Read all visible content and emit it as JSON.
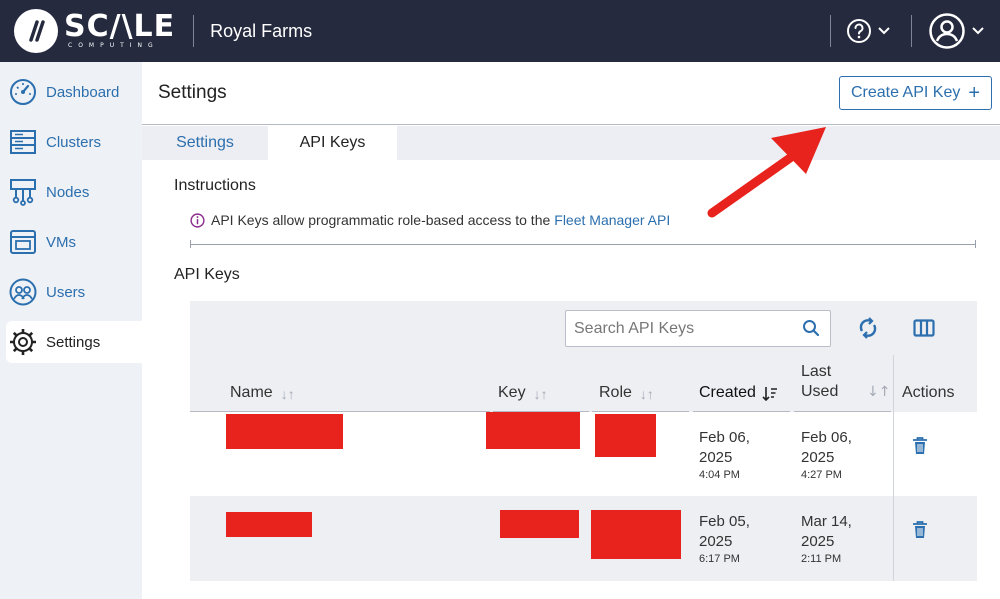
{
  "header": {
    "logo_word": "SC/\\LE",
    "logo_sub": "COMPUTING",
    "org_name": "Royal Farms"
  },
  "sidebar": {
    "items": [
      {
        "label": "Dashboard",
        "icon": "dashboard-gauge-icon"
      },
      {
        "label": "Clusters",
        "icon": "clusters-icon"
      },
      {
        "label": "Nodes",
        "icon": "nodes-icon"
      },
      {
        "label": "VMs",
        "icon": "vms-icon"
      },
      {
        "label": "Users",
        "icon": "users-icon"
      },
      {
        "label": "Settings",
        "icon": "gear-icon",
        "active": true
      }
    ]
  },
  "page": {
    "title": "Settings",
    "create_button": "Create API Key",
    "tabs": [
      {
        "label": "Settings",
        "active": false
      },
      {
        "label": "API Keys",
        "active": true
      }
    ],
    "instructions_title": "Instructions",
    "instructions_text": "API Keys allow programmatic role-based access to the",
    "instructions_link": "Fleet Manager API",
    "api_keys_title": "API Keys"
  },
  "table": {
    "search_placeholder": "Search API Keys",
    "columns": {
      "name": "Name",
      "key": "Key",
      "role": "Role",
      "created": "Created",
      "last_used_1": "Last",
      "last_used_2": "Used",
      "actions": "Actions"
    },
    "rows": [
      {
        "created_date_1": "Feb 06,",
        "created_date_2": "2025",
        "created_time": "4:04 PM",
        "used_date_1": "Feb 06,",
        "used_date_2": "2025",
        "used_time": "4:27 PM"
      },
      {
        "created_date_1": "Feb 05,",
        "created_date_2": "2025",
        "created_time": "6:17 PM",
        "used_date_1": "Mar 14,",
        "used_date_2": "2025",
        "used_time": "2:11 PM"
      }
    ]
  },
  "colors": {
    "header_bg": "#252a3e",
    "accent": "#2c6fae",
    "redaction": "#e8221c",
    "annotation_arrow": "#e8221c"
  }
}
